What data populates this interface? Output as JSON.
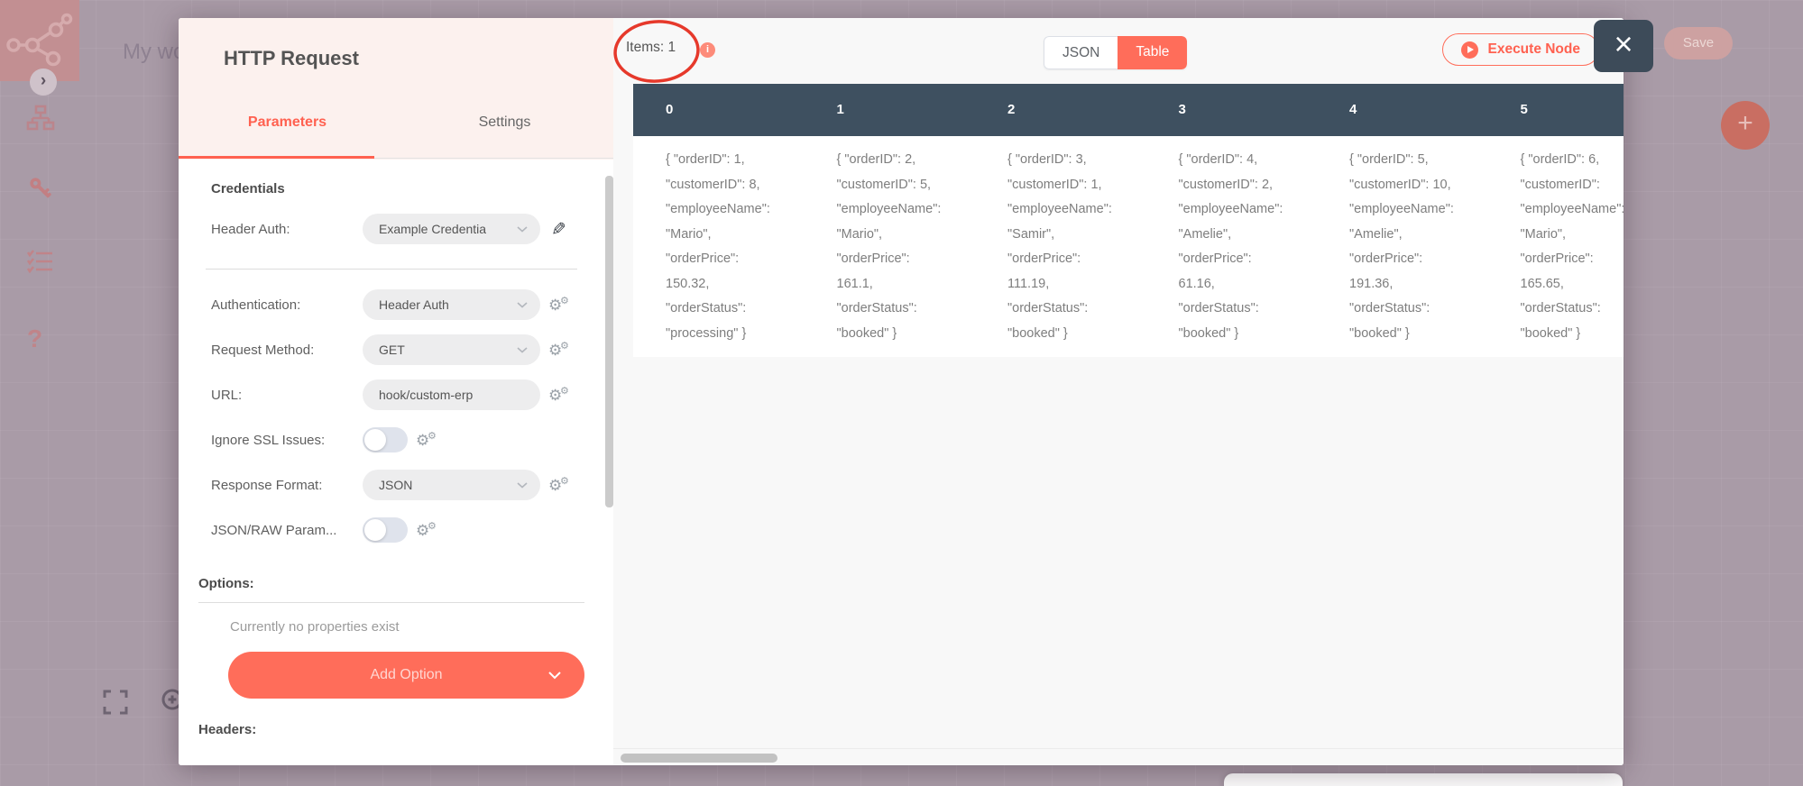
{
  "workspace": {
    "workflow_title": "My wo",
    "save_button": "Save",
    "plus_button": "+",
    "collapse_chevron": "›",
    "help_icon_label": "?"
  },
  "modal": {
    "title": "HTTP Request",
    "tabs": {
      "parameters": "Parameters",
      "settings": "Settings"
    },
    "parameters": {
      "credentials_heading": "Credentials",
      "credential_row": {
        "label": "Header Auth:",
        "value": "Example Credentia"
      },
      "rows": [
        {
          "label": "Authentication:",
          "type": "select",
          "value": "Header Auth"
        },
        {
          "label": "Request Method:",
          "type": "select",
          "value": "GET"
        },
        {
          "label": "URL:",
          "type": "text",
          "value": "hook/custom-erp"
        },
        {
          "label": "Ignore SSL Issues:",
          "type": "toggle",
          "value": false
        },
        {
          "label": "Response Format:",
          "type": "select",
          "value": "JSON"
        },
        {
          "label": "JSON/RAW Param...",
          "type": "toggle",
          "value": false
        }
      ],
      "options_heading": "Options:",
      "options_empty": "Currently no properties exist",
      "add_option_label": "Add Option",
      "headers_heading": "Headers:"
    },
    "output": {
      "items_label": "Items: 1",
      "view_toggle": {
        "json": "JSON",
        "table": "Table",
        "active": "Table"
      },
      "execute_button": "Execute Node",
      "table_columns": [
        {
          "header": "0",
          "lines": [
            "{ \"orderID\": 1,",
            "\"customerID\": 8,",
            "\"employeeName\":",
            "\"Mario\",",
            "\"orderPrice\":",
            "150.32,",
            "\"orderStatus\":",
            "\"processing\" }"
          ]
        },
        {
          "header": "1",
          "lines": [
            "{ \"orderID\": 2,",
            "\"customerID\": 5,",
            "\"employeeName\":",
            "\"Mario\",",
            "\"orderPrice\":",
            "161.1,",
            "\"orderStatus\":",
            "\"booked\" }"
          ]
        },
        {
          "header": "2",
          "lines": [
            "{ \"orderID\": 3,",
            "\"customerID\": 1,",
            "\"employeeName\":",
            "\"Samir\",",
            "\"orderPrice\":",
            "111.19,",
            "\"orderStatus\":",
            "\"booked\" }"
          ]
        },
        {
          "header": "3",
          "lines": [
            "{ \"orderID\": 4,",
            "\"customerID\": 2,",
            "\"employeeName\":",
            "\"Amelie\",",
            "\"orderPrice\":",
            "61.16,",
            "\"orderStatus\":",
            "\"booked\" }"
          ]
        },
        {
          "header": "4",
          "lines": [
            "{ \"orderID\": 5,",
            "\"customerID\": 10,",
            "\"employeeName\":",
            "\"Amelie\",",
            "\"orderPrice\":",
            "191.36,",
            "\"orderStatus\":",
            "\"booked\" }"
          ]
        },
        {
          "header": "5",
          "lines": [
            "{ \"orderID\": 6,",
            "\"customerID\":",
            "\"employeeName\":",
            "\"Mario\",",
            "\"orderPrice\":",
            "165.65,",
            "\"orderStatus\":",
            "\"booked\" }"
          ]
        }
      ]
    }
  },
  "colors": {
    "accent": "#ff6d5a",
    "table_header": "#3e5060",
    "annotation_red": "#e6392b",
    "overlay_mauve": "#a99ba7",
    "modal_header_pink": "#fcf1ee"
  }
}
